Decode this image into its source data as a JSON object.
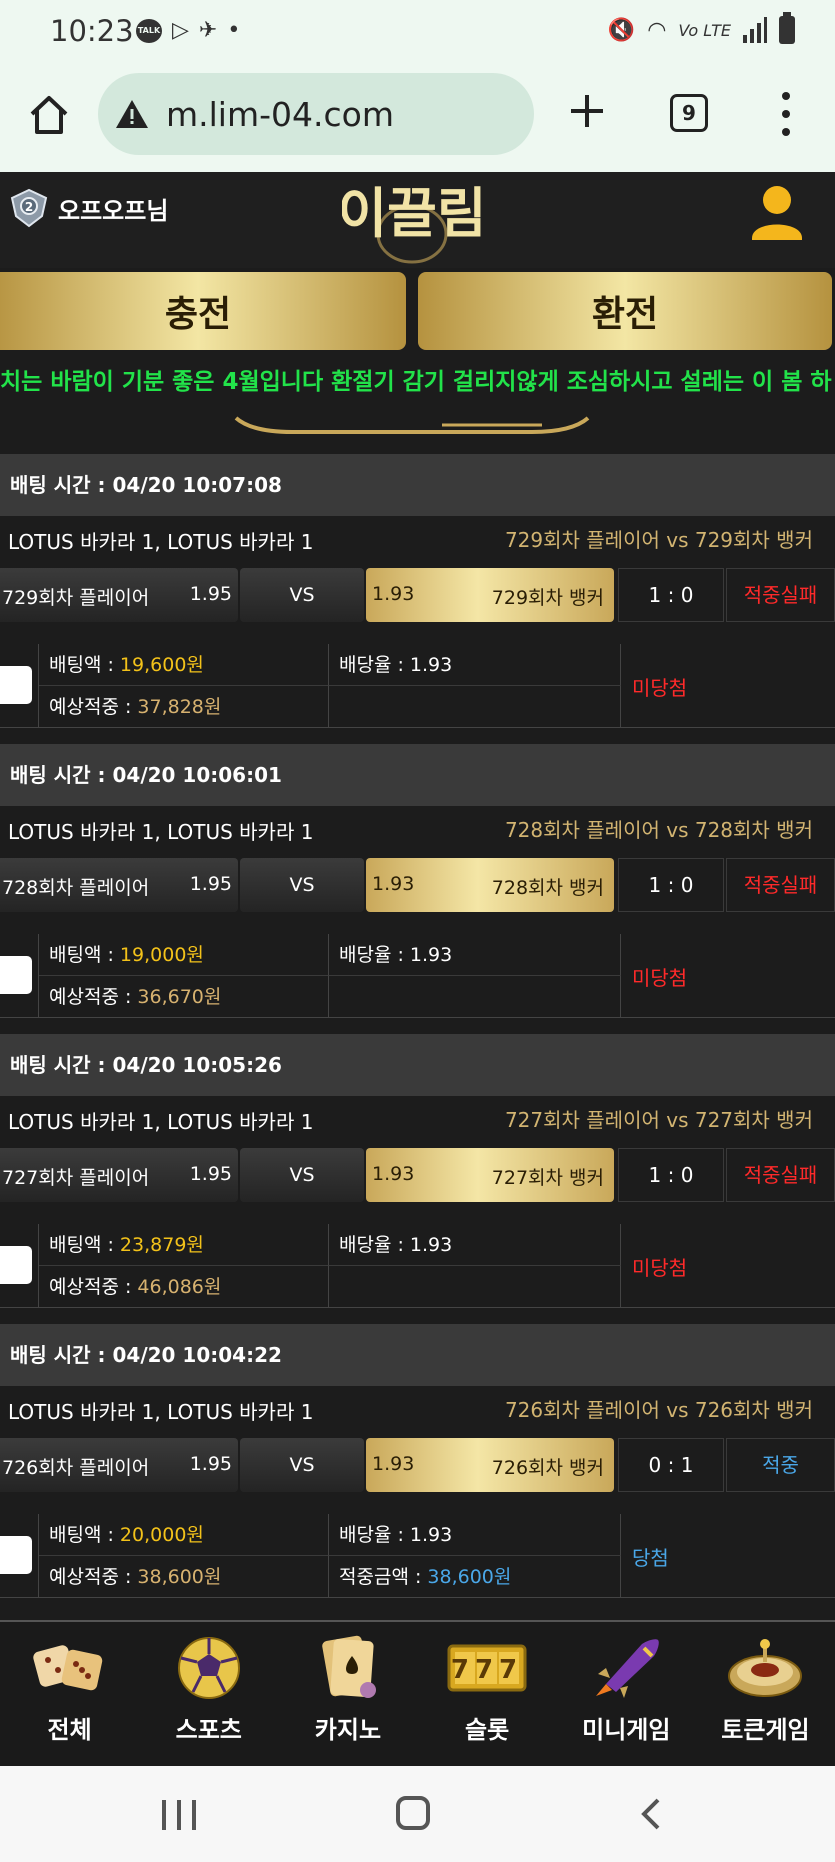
{
  "status_bar": {
    "time": "10:23",
    "talk_icon_text": "TALK",
    "lte_text": "Vo LTE"
  },
  "browser": {
    "url": "m.lim-04.com",
    "tab_count": "9"
  },
  "header": {
    "username": "오프오프님",
    "logo_text": "이끌림",
    "charge_label": "충전",
    "exchange_label": "환전",
    "notice": "치는 바람이 기분 좋은 4월입니다 환절기 감기 걸리지않게 조심하시고 설레는 이 봄 하"
  },
  "labels": {
    "bet_amount": "배팅액 : ",
    "odds_rate": "배당율 : ",
    "expected_win": "예상적중 : ",
    "win_amount": "적중금액 : ",
    "vs": "VS"
  },
  "bets": [
    {
      "time": "배팅 시간 : 04/20 10:07:08",
      "league": "LOTUS 바카라 1, LOTUS 바카라 1",
      "match": "729회차 플레이어  vs  729회차 뱅커",
      "home_name": "729회차 플레이어",
      "home_odd": "1.95",
      "away_odd": "1.93",
      "away_name": "729회차 뱅커",
      "score": "1 : 0",
      "result": "적중실패",
      "bet_amount": "19,600원",
      "odds": "1.93",
      "expected": "37,828원",
      "win_amount": "",
      "status": "미당첨"
    },
    {
      "time": "배팅 시간 : 04/20 10:06:01",
      "league": "LOTUS 바카라 1, LOTUS 바카라 1",
      "match": "728회차 플레이어  vs  728회차 뱅커",
      "home_name": "728회차 플레이어",
      "home_odd": "1.95",
      "away_odd": "1.93",
      "away_name": "728회차 뱅커",
      "score": "1 : 0",
      "result": "적중실패",
      "bet_amount": "19,000원",
      "odds": "1.93",
      "expected": "36,670원",
      "win_amount": "",
      "status": "미당첨"
    },
    {
      "time": "배팅 시간 : 04/20 10:05:26",
      "league": "LOTUS 바카라 1, LOTUS 바카라 1",
      "match": "727회차 플레이어  vs  727회차 뱅커",
      "home_name": "727회차 플레이어",
      "home_odd": "1.95",
      "away_odd": "1.93",
      "away_name": "727회차 뱅커",
      "score": "1 : 0",
      "result": "적중실패",
      "bet_amount": "23,879원",
      "odds": "1.93",
      "expected": "46,086원",
      "win_amount": "",
      "status": "미당첨"
    },
    {
      "time": "배팅 시간 : 04/20 10:04:22",
      "league": "LOTUS 바카라 1, LOTUS 바카라 1",
      "match": "726회차 플레이어  vs  726회차 뱅커",
      "home_name": "726회차 플레이어",
      "home_odd": "1.95",
      "away_odd": "1.93",
      "away_name": "726회차 뱅커",
      "score": "0 : 1",
      "result": "적중",
      "bet_amount": "20,000원",
      "odds": "1.93",
      "expected": "38,600원",
      "win_amount": "38,600원",
      "status": "당첨"
    }
  ],
  "menu": [
    {
      "label": "전체",
      "icon": "dice-icon"
    },
    {
      "label": "스포츠",
      "icon": "soccer-ball-icon"
    },
    {
      "label": "카지노",
      "icon": "cards-icon"
    },
    {
      "label": "슬롯",
      "icon": "slot-777-icon",
      "icon_text": "777"
    },
    {
      "label": "미니게임",
      "icon": "rocket-icon"
    },
    {
      "label": "토큰게임",
      "icon": "roulette-icon"
    }
  ],
  "colors": {
    "accent_gold": "#d2b471",
    "lose": "#ff2a2a",
    "win": "#4aa7e8",
    "notice_green": "#22e34a"
  }
}
